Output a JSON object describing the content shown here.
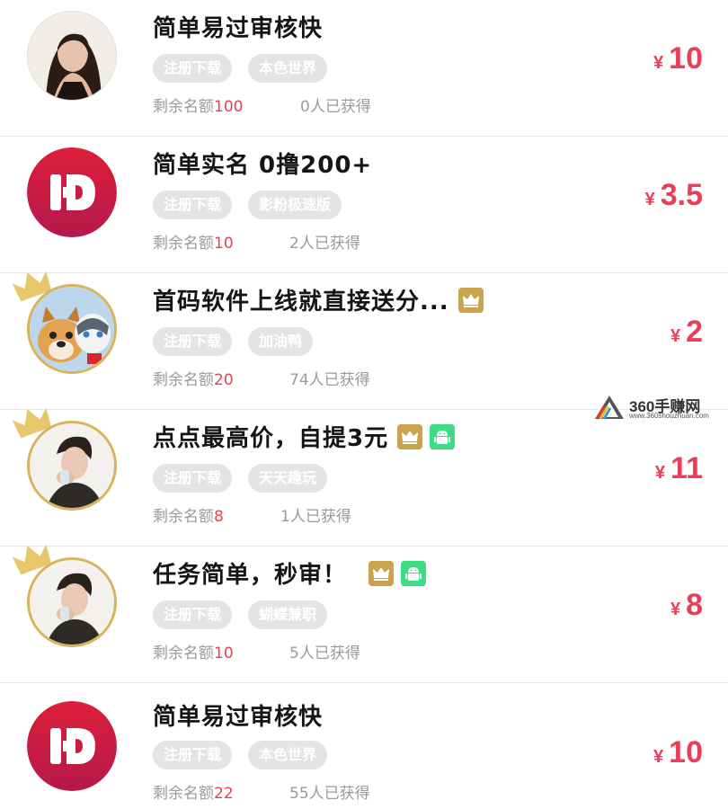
{
  "tasks": [
    {
      "title": "简单易过审核快",
      "tags": [
        "注册下载",
        "本色世界"
      ],
      "remaining_label": "剩余名额",
      "remaining": "100",
      "obtained": "0人已获得",
      "currency": "¥",
      "price": "10",
      "avatar": "portrait-woman",
      "badges": []
    },
    {
      "title": "简单实名  0撸200+",
      "tags": [
        "注册下载",
        "影粉极速版"
      ],
      "remaining_label": "剩余名额",
      "remaining": "10",
      "obtained": "2人已获得",
      "currency": "¥",
      "price": "3.5",
      "avatar": "app-logo-iD",
      "badges": []
    },
    {
      "title": "首码软件上线就直接送分...",
      "tags": [
        "注册下载",
        "加油鸭"
      ],
      "remaining_label": "剩余名额",
      "remaining": "20",
      "obtained": "74人已获得",
      "currency": "¥",
      "price": "2",
      "avatar": "dogs",
      "badges": [
        "crown-badge"
      ]
    },
    {
      "title": "点点最高价，自提3元",
      "tags": [
        "注册下载",
        "天天趣玩"
      ],
      "remaining_label": "剩余名额",
      "remaining": "8",
      "obtained": "1人已获得",
      "currency": "¥",
      "price": "11",
      "avatar": "portrait-man",
      "badges": [
        "crown-badge",
        "android-badge"
      ]
    },
    {
      "title": "任务简单，秒审！",
      "tags": [
        "注册下载",
        "蝴蝶兼职"
      ],
      "remaining_label": "剩余名额",
      "remaining": "10",
      "obtained": "5人已获得",
      "currency": "¥",
      "price": "8",
      "avatar": "portrait-man",
      "badges": [
        "crown-badge",
        "android-badge"
      ]
    },
    {
      "title": "简单易过审核快",
      "tags": [
        "注册下载",
        "本色世界"
      ],
      "remaining_label": "剩余名额",
      "remaining": "22",
      "obtained": "55人已获得",
      "currency": "¥",
      "price": "10",
      "avatar": "app-logo-iD",
      "badges": []
    }
  ],
  "watermark": {
    "title": "360手赚网",
    "url": "www.360shouzhuan.com"
  },
  "colors": {
    "price": "#e83e57",
    "remaining_number": "#e2434f",
    "tag_bg": "#e4e4e4",
    "crown_gold": "#c9a34e",
    "android_green": "#3ddc84",
    "logo_red": "#d01f3c"
  }
}
